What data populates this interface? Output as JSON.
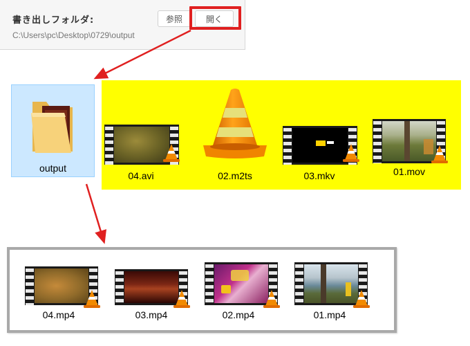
{
  "panel": {
    "title": "書き出しフォルダ:",
    "path": "C:\\Users\\pc\\Desktop\\0729\\output",
    "browse_label": "参照",
    "open_label": "開く"
  },
  "folder": {
    "label": "output",
    "icon": "folder-icon"
  },
  "source_files": [
    {
      "name": "04.avi"
    },
    {
      "name": "02.m2ts"
    },
    {
      "name": "03.mkv"
    },
    {
      "name": "01.mov"
    }
  ],
  "output_files": [
    {
      "name": "04.mp4"
    },
    {
      "name": "03.mp4"
    },
    {
      "name": "02.mp4"
    },
    {
      "name": "01.mp4"
    }
  ],
  "colors": {
    "highlight_red": "#e02020",
    "strip_yellow": "#ffff00",
    "folder_selection": "#cce8ff",
    "vlc_orange": "#f28a00"
  }
}
